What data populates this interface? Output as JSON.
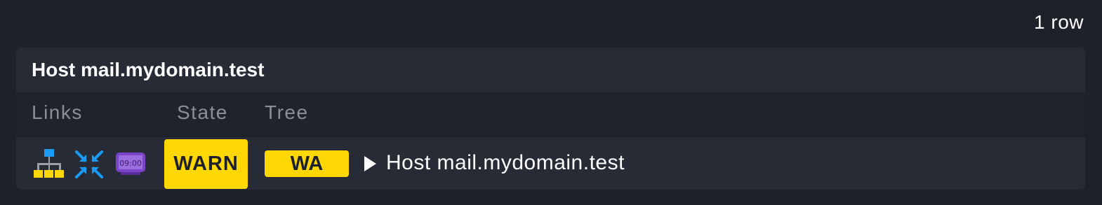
{
  "summary": {
    "row_count": "1 row"
  },
  "panel": {
    "title": "Host mail.mydomain.test",
    "columns": {
      "links": "Links",
      "state": "State",
      "tree": "Tree"
    },
    "row": {
      "link_icons": [
        "topology-icon",
        "compress-icon",
        "clock-display-icon"
      ],
      "clock_text": "09:00",
      "state": "WARN",
      "tree_state": "WA",
      "tree_label": "Host mail.mydomain.test"
    }
  },
  "colors": {
    "background": "#1e2129",
    "panel": "#262b35",
    "warn": "#ffd703",
    "blue_icon": "#1b9bf5",
    "clock_purple": "#7a43c8"
  }
}
